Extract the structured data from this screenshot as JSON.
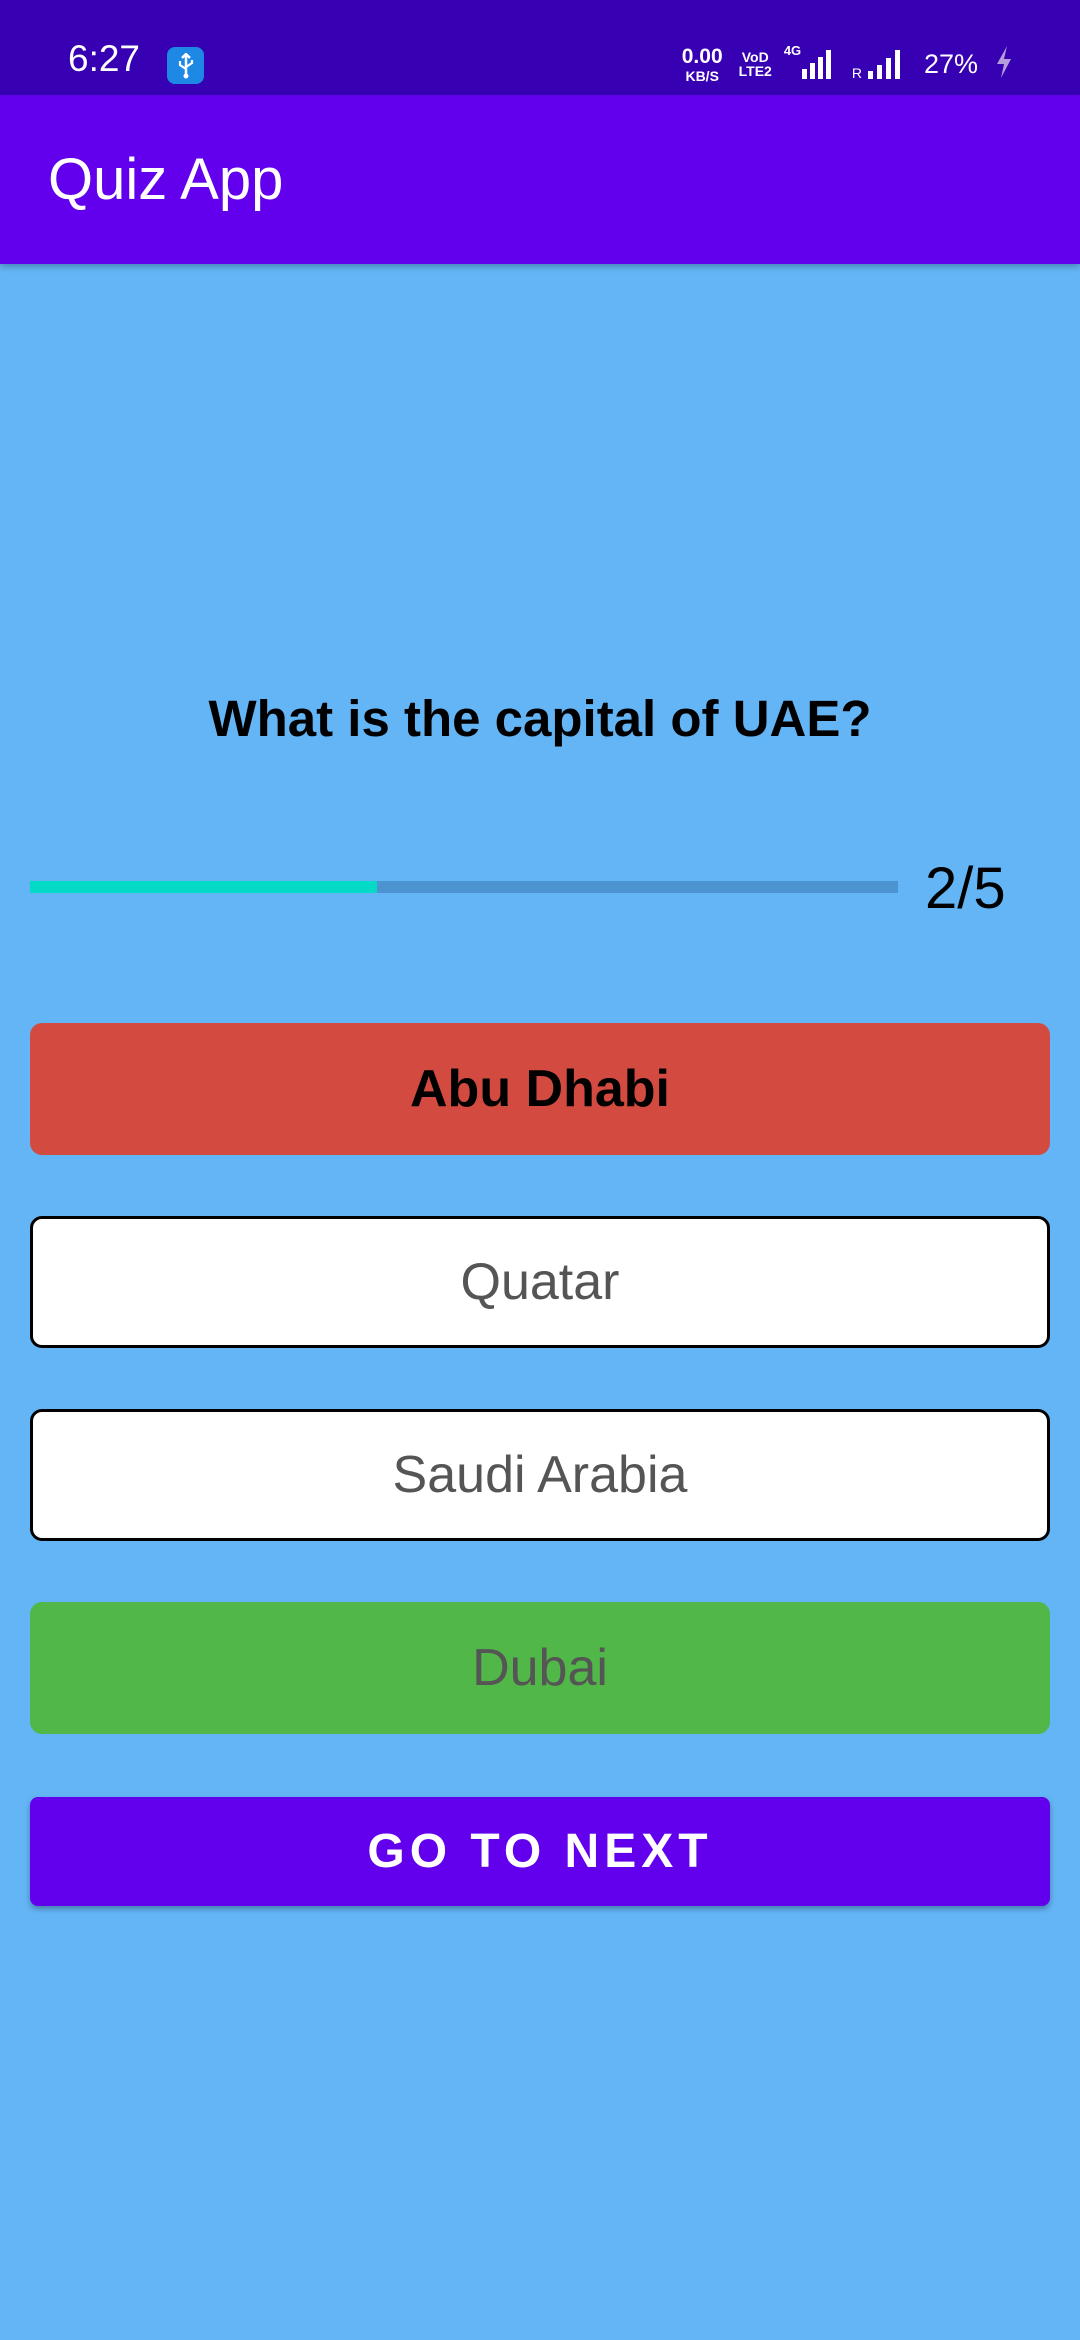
{
  "status_bar": {
    "time": "6:27",
    "net_speed_value": "0.00",
    "net_speed_unit": "KB/S",
    "volte_line1": "VoD",
    "volte_line2": "LTE2",
    "network_type": "4G",
    "roaming": "R",
    "battery": "27%",
    "icons": [
      "usb-icon",
      "signal-icon",
      "signal-icon",
      "charging-icon"
    ]
  },
  "app_bar": {
    "title": "Quiz App",
    "color": "#6200ee"
  },
  "quiz": {
    "question": "What is the capital of UAE?",
    "progress": {
      "current": 2,
      "total": 5,
      "fraction": 0.4,
      "label": "2/5"
    },
    "options": [
      {
        "label": "Abu Dhabi",
        "state": "wrong",
        "color": "#d34b40"
      },
      {
        "label": "Quatar",
        "state": "unselected",
        "color": "#ffffff"
      },
      {
        "label": "Saudi Arabia",
        "state": "unselected",
        "color": "#ffffff"
      },
      {
        "label": "Dubai",
        "state": "correct",
        "color": "#50b748"
      }
    ],
    "next_button_label": "GO TO NEXT"
  },
  "colors": {
    "background": "#64b5f6",
    "status_bar": "#3700b3",
    "progress_fill": "#03dac5",
    "progress_track": "#4c94d0"
  }
}
